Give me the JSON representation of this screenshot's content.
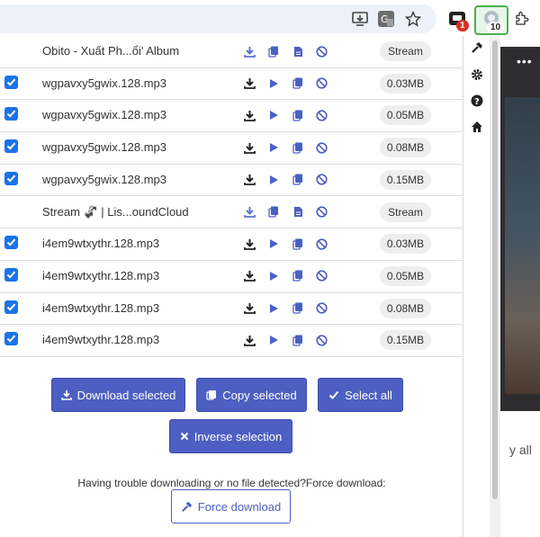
{
  "browser": {
    "icons": {
      "screen": "install-app-icon",
      "translate": "translate-icon",
      "star": "bookmark-star-icon",
      "ext1": "chat-extension-icon",
      "ext2": "stream-recorder-extension-icon",
      "puzzle": "extensions-puzzle-icon"
    },
    "ext1_badge": "1",
    "ext2_badge": "10"
  },
  "rows": [
    {
      "checked": false,
      "name": "Obito - Xuất Ph...ổi' Album",
      "size": "Stream",
      "kind": "stream"
    },
    {
      "checked": true,
      "name": "wgpavxy5gwix.128.mp3",
      "size": "0.03MB",
      "kind": "file"
    },
    {
      "checked": true,
      "name": "wgpavxy5gwix.128.mp3",
      "size": "0.05MB",
      "kind": "file"
    },
    {
      "checked": true,
      "name": "wgpavxy5gwix.128.mp3",
      "size": "0.08MB",
      "kind": "file"
    },
    {
      "checked": true,
      "name": "wgpavxy5gwix.128.mp3",
      "size": "0.15MB",
      "kind": "file"
    },
    {
      "checked": false,
      "name": "Stream 🦨 | Lis...oundCloud",
      "size": "Stream",
      "kind": "stream"
    },
    {
      "checked": true,
      "name": "i4em9wtxythr.128.mp3",
      "size": "0.03MB",
      "kind": "file"
    },
    {
      "checked": true,
      "name": "i4em9wtxythr.128.mp3",
      "size": "0.05MB",
      "kind": "file"
    },
    {
      "checked": true,
      "name": "i4em9wtxythr.128.mp3",
      "size": "0.08MB",
      "kind": "file"
    },
    {
      "checked": true,
      "name": "i4em9wtxythr.128.mp3",
      "size": "0.15MB",
      "kind": "file"
    }
  ],
  "actions": {
    "download_selected": "Download selected",
    "copy_selected": "Copy selected",
    "select_all": "Select all",
    "inverse_selection": "Inverse selection"
  },
  "trouble_text": "Having trouble downloading or no file detected?Force download:",
  "force_download": "Force download",
  "side_icons": [
    "hammer-icon",
    "gear-icon",
    "help-icon",
    "home-icon"
  ],
  "background_page": {
    "dots": "•••",
    "text": "y all"
  },
  "colors": {
    "accent": "#4d5fc2",
    "checkbox": "#1a73e8",
    "highlight": "#4caf50"
  }
}
